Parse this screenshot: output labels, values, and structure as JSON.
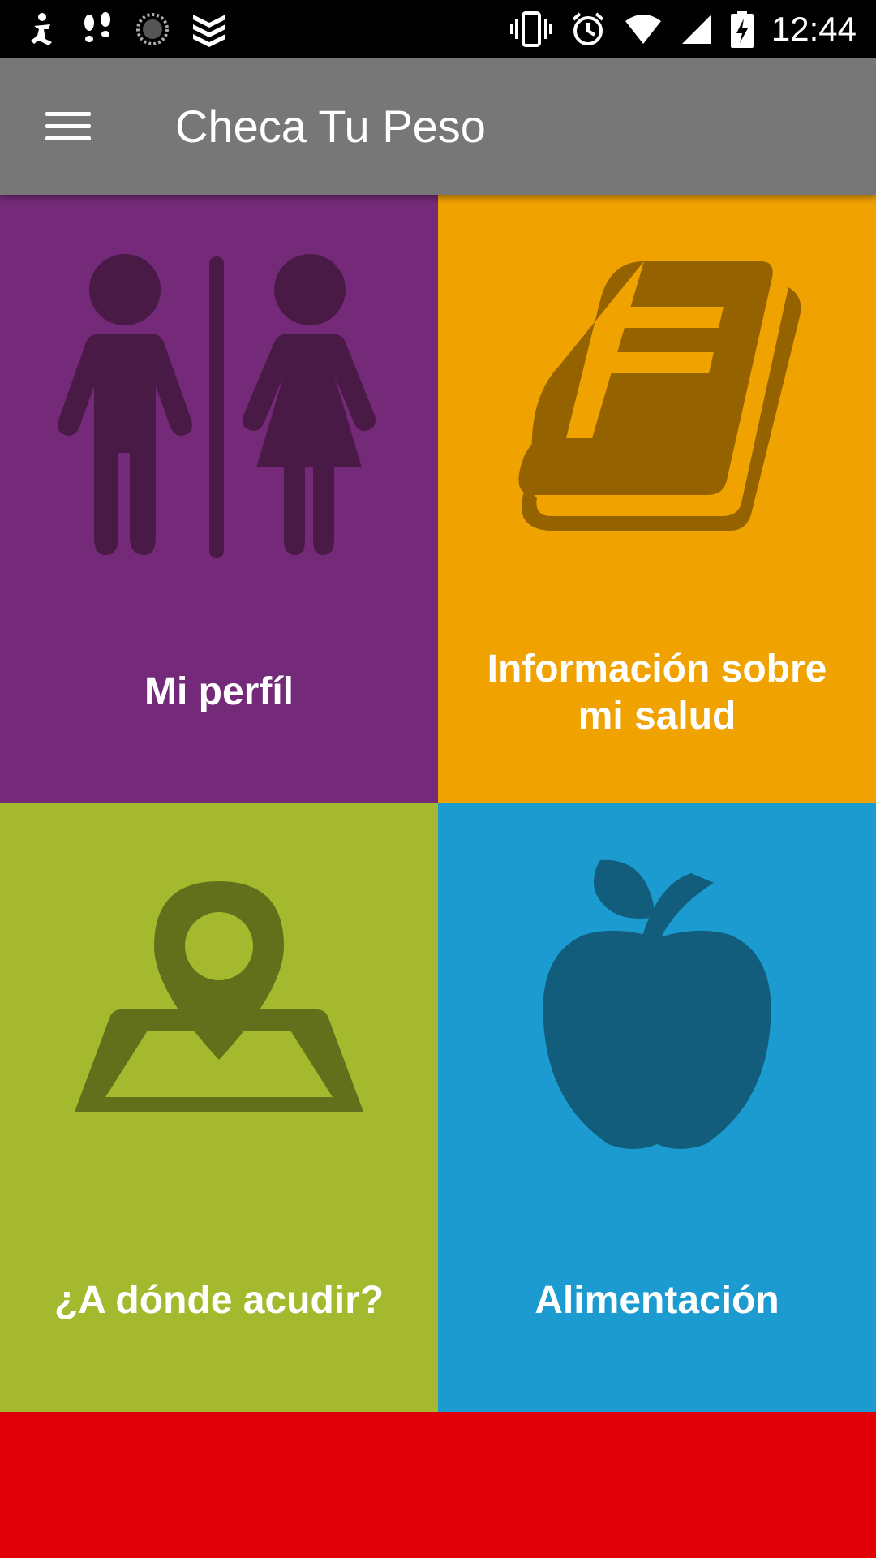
{
  "status_bar": {
    "time": "12:44",
    "left_icons": [
      "accessibility-icon",
      "footsteps-icon",
      "loading-icon",
      "layers-icon"
    ],
    "right_icons": [
      "vibrate-icon",
      "alarm-icon",
      "wifi-icon",
      "cellular-icon",
      "battery-charging-icon"
    ]
  },
  "app_bar": {
    "title": "Checa Tu Peso",
    "menu_icon": "hamburger-menu-icon"
  },
  "tiles": [
    {
      "label": "Mi perfíl",
      "icon": "people-icon",
      "color": "#742a78"
    },
    {
      "label": "Información sobre mi salud",
      "icon": "book-icon",
      "color": "#f0a200"
    },
    {
      "label": "¿A dónde acudir?",
      "icon": "map-pin-icon",
      "color": "#a5b92e"
    },
    {
      "label": "Alimentación",
      "icon": "apple-icon",
      "color": "#1b9bd0"
    }
  ],
  "bottom_color": "#e00008"
}
